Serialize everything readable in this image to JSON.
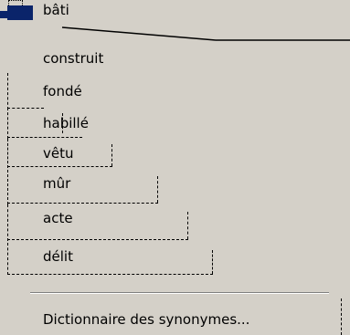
{
  "menu": {
    "items": [
      {
        "label": "bâti"
      },
      {
        "label": "construit"
      },
      {
        "label": "fondé"
      },
      {
        "label": "habillé"
      },
      {
        "label": "vêtu"
      },
      {
        "label": "mûr"
      },
      {
        "label": "acte"
      },
      {
        "label": "délit"
      }
    ],
    "dictionary_label": "Dictionnaire des synonymes..."
  },
  "colors": {
    "menu_background": "#d4d0c8",
    "selection": "#0a246a",
    "text": "#000000",
    "separator_dark": "#808080",
    "separator_light": "#ffffff"
  }
}
